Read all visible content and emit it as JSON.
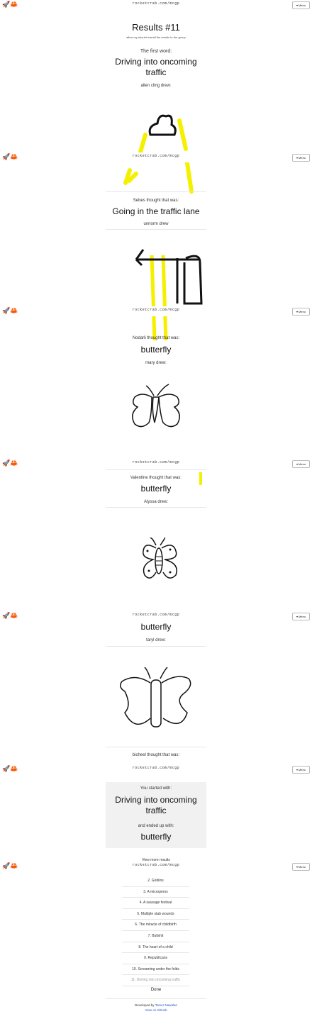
{
  "topbar": {
    "url": "rocketcrab.com/mcgp",
    "menu_label": "▾ Menu"
  },
  "results": {
    "title": "Results #11",
    "subtitle": "allow my should overall the results to the group",
    "first_word_label": "The first word:",
    "first_word": "Driving into oncoming traffic",
    "drawers": [
      "allen cling drew:",
      "unnorm drew",
      "mary drew:",
      "Alyssa drew:",
      "taryl drew:"
    ],
    "guessers": [
      {
        "label": "Sebes thought that was:",
        "guess": "Going in the traffic lane"
      },
      {
        "label": "Nodarli thought that was:",
        "guess": "butterfly"
      },
      {
        "label": "Valentine thought that was:",
        "guess": "butterfly"
      },
      {
        "label": "",
        "guess": "butterfly"
      },
      {
        "label": "bicheel thought that was:",
        "guess": ""
      }
    ]
  },
  "summary": {
    "started_label": "You started with:",
    "started": "Driving into oncoming traffic",
    "ended_label": "and ended up with:",
    "ended": "butterfly",
    "view_more": "View more results"
  },
  "rounds": [
    "2. Goblins",
    "3. A microperns",
    "4. A sausage festival",
    "5. Multiple stab wounds",
    "6. The miracle of childbirth",
    "7. Bullshit",
    "8. The heart of a child",
    "9. Republicans",
    "10. Screaming under the folds",
    "11. Driving into oncoming traffic"
  ],
  "done_label": "Done",
  "footer": {
    "credit_prefix": "Developed by",
    "author": "Tamer Nawalan",
    "source": "View on GitHub"
  },
  "colors": {
    "yellow": "#f5f000",
    "ink": "#111111"
  }
}
